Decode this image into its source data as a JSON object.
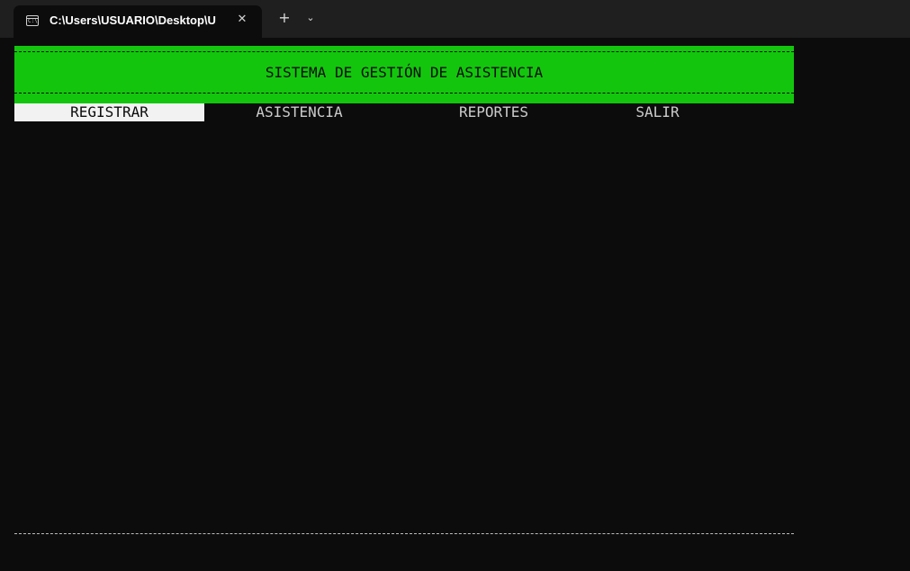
{
  "window": {
    "tab_title": "C:\\Users\\USUARIO\\Desktop\\U",
    "tab_icon": "terminal-icon",
    "close_glyph": "✕",
    "new_tab_glyph": "+",
    "dropdown_glyph": "⌄"
  },
  "console": {
    "banner_title": "SISTEMA DE GESTIÓN DE ASISTENCIA",
    "banner_color": "#13c60d",
    "menu": [
      {
        "label": "REGISTRAR",
        "selected": true
      },
      {
        "label": "ASISTENCIA",
        "selected": false
      },
      {
        "label": "REPORTES",
        "selected": false
      },
      {
        "label": "SALIR",
        "selected": false
      }
    ]
  }
}
